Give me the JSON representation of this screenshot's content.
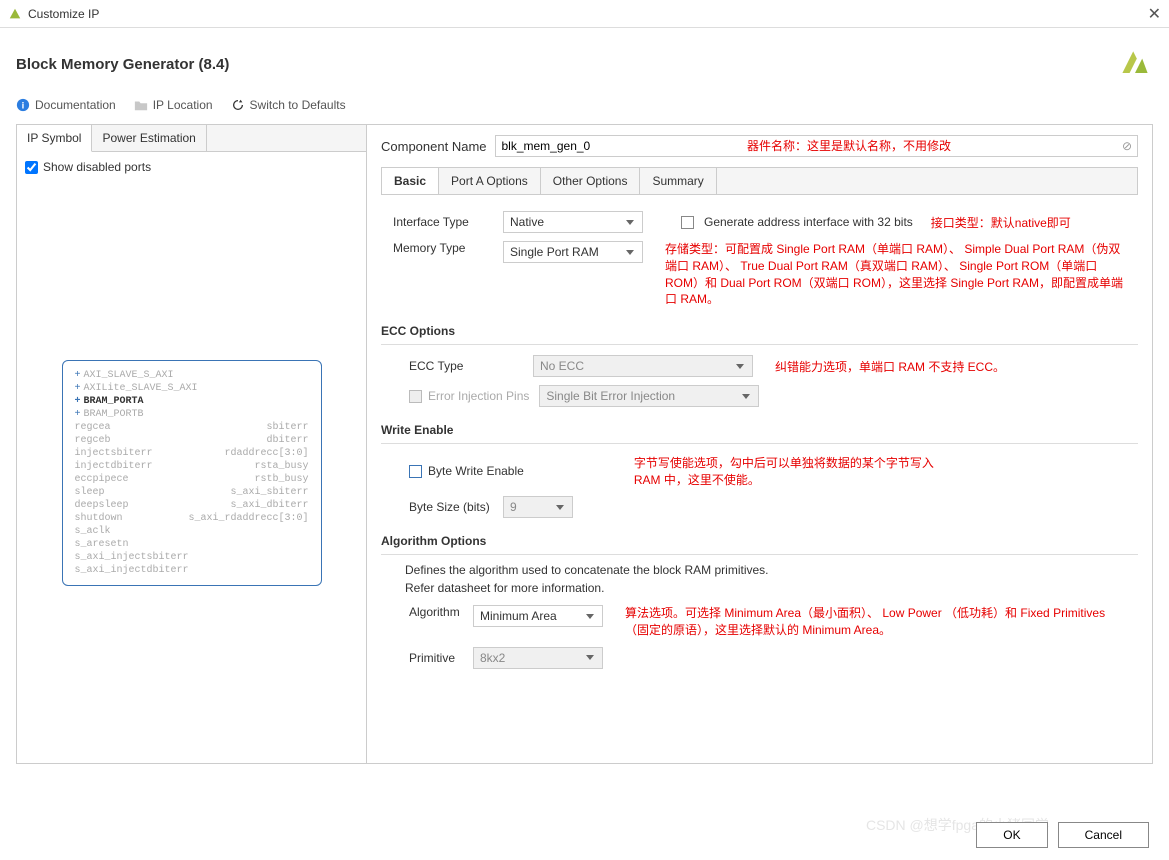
{
  "window": {
    "title": "Customize IP"
  },
  "header": {
    "title": "Block Memory Generator (8.4)"
  },
  "toolbar": {
    "doc": "Documentation",
    "iploc": "IP Location",
    "switch": "Switch to Defaults"
  },
  "left": {
    "tabs": [
      "IP Symbol",
      "Power Estimation"
    ],
    "showDisabled": "Show disabled ports",
    "ports_top": [
      {
        "name": "AXI_SLAVE_S_AXI",
        "active": false
      },
      {
        "name": "AXILite_SLAVE_S_AXI",
        "active": false
      },
      {
        "name": "BRAM_PORTA",
        "active": true
      },
      {
        "name": "BRAM_PORTB",
        "active": false
      }
    ],
    "ports_left": [
      "regcea",
      "regceb",
      "injectsbiterr",
      "injectdbiterr",
      "eccpipece",
      "sleep",
      "deepsleep",
      "shutdown",
      "s_aclk",
      "s_aresetn",
      "s_axi_injectsbiterr",
      "s_axi_injectdbiterr"
    ],
    "ports_right": [
      "sbiterr",
      "dbiterr",
      "rdaddrecc[3:0]",
      "rsta_busy",
      "rstb_busy",
      "s_axi_sbiterr",
      "s_axi_dbiterr",
      "s_axi_rdaddrecc[3:0]",
      "",
      "",
      "",
      ""
    ]
  },
  "componentNameLabel": "Component Name",
  "componentName": "blk_mem_gen_0",
  "rtabs": [
    "Basic",
    "Port A Options",
    "Other Options",
    "Summary"
  ],
  "basic": {
    "interfaceTypeLabel": "Interface Type",
    "interfaceType": "Native",
    "gen32Label": "Generate address interface with 32 bits",
    "memoryTypeLabel": "Memory Type",
    "memoryType": "Single Port RAM",
    "eccHead": "ECC Options",
    "eccTypeLabel": "ECC Type",
    "eccType": "No ECC",
    "errInjLabel": "Error Injection Pins",
    "errInj": "Single Bit Error Injection",
    "weHead": "Write Enable",
    "byteWELabel": "Byte Write Enable",
    "byteSizeLabel": "Byte Size (bits)",
    "byteSize": "9",
    "algoHead": "Algorithm Options",
    "algoDesc1": "Defines the algorithm used to concatenate the block RAM primitives.",
    "algoDesc2": "Refer datasheet for more information.",
    "algorithmLabel": "Algorithm",
    "algorithm": "Minimum Area",
    "primitiveLabel": "Primitive",
    "primitive": "8kx2"
  },
  "annotations": {
    "compName": "器件名称：这里是默认名称，不用修改",
    "interfaceType": "接口类型：默认native即可",
    "memoryType": "存储类型：可配置成 Single Port RAM（单端口 RAM）、 Simple Dual Port RAM（伪双端口 RAM）、 True Dual Port RAM（真双端口 RAM）、 Single Port ROM（单端口 ROM）和 Dual Port ROM（双端口 ROM），这里选择 Single Port RAM，即配置成单端口 RAM。",
    "ecc": "纠错能力选项，单端口 RAM 不支持 ECC。",
    "we": "字节写使能选项，勾中后可以单独将数据的某个字节写入 RAM 中，这里不使能。",
    "algo": "算法选项。可选择 Minimum Area（最小面积）、 Low Power （低功耗）和 Fixed Primitives（固定的原语），这里选择默认的 Minimum Area。"
  },
  "footer": {
    "ok": "OK",
    "cancel": "Cancel"
  },
  "watermark": "CSDN @想学fpga的小猪同学"
}
